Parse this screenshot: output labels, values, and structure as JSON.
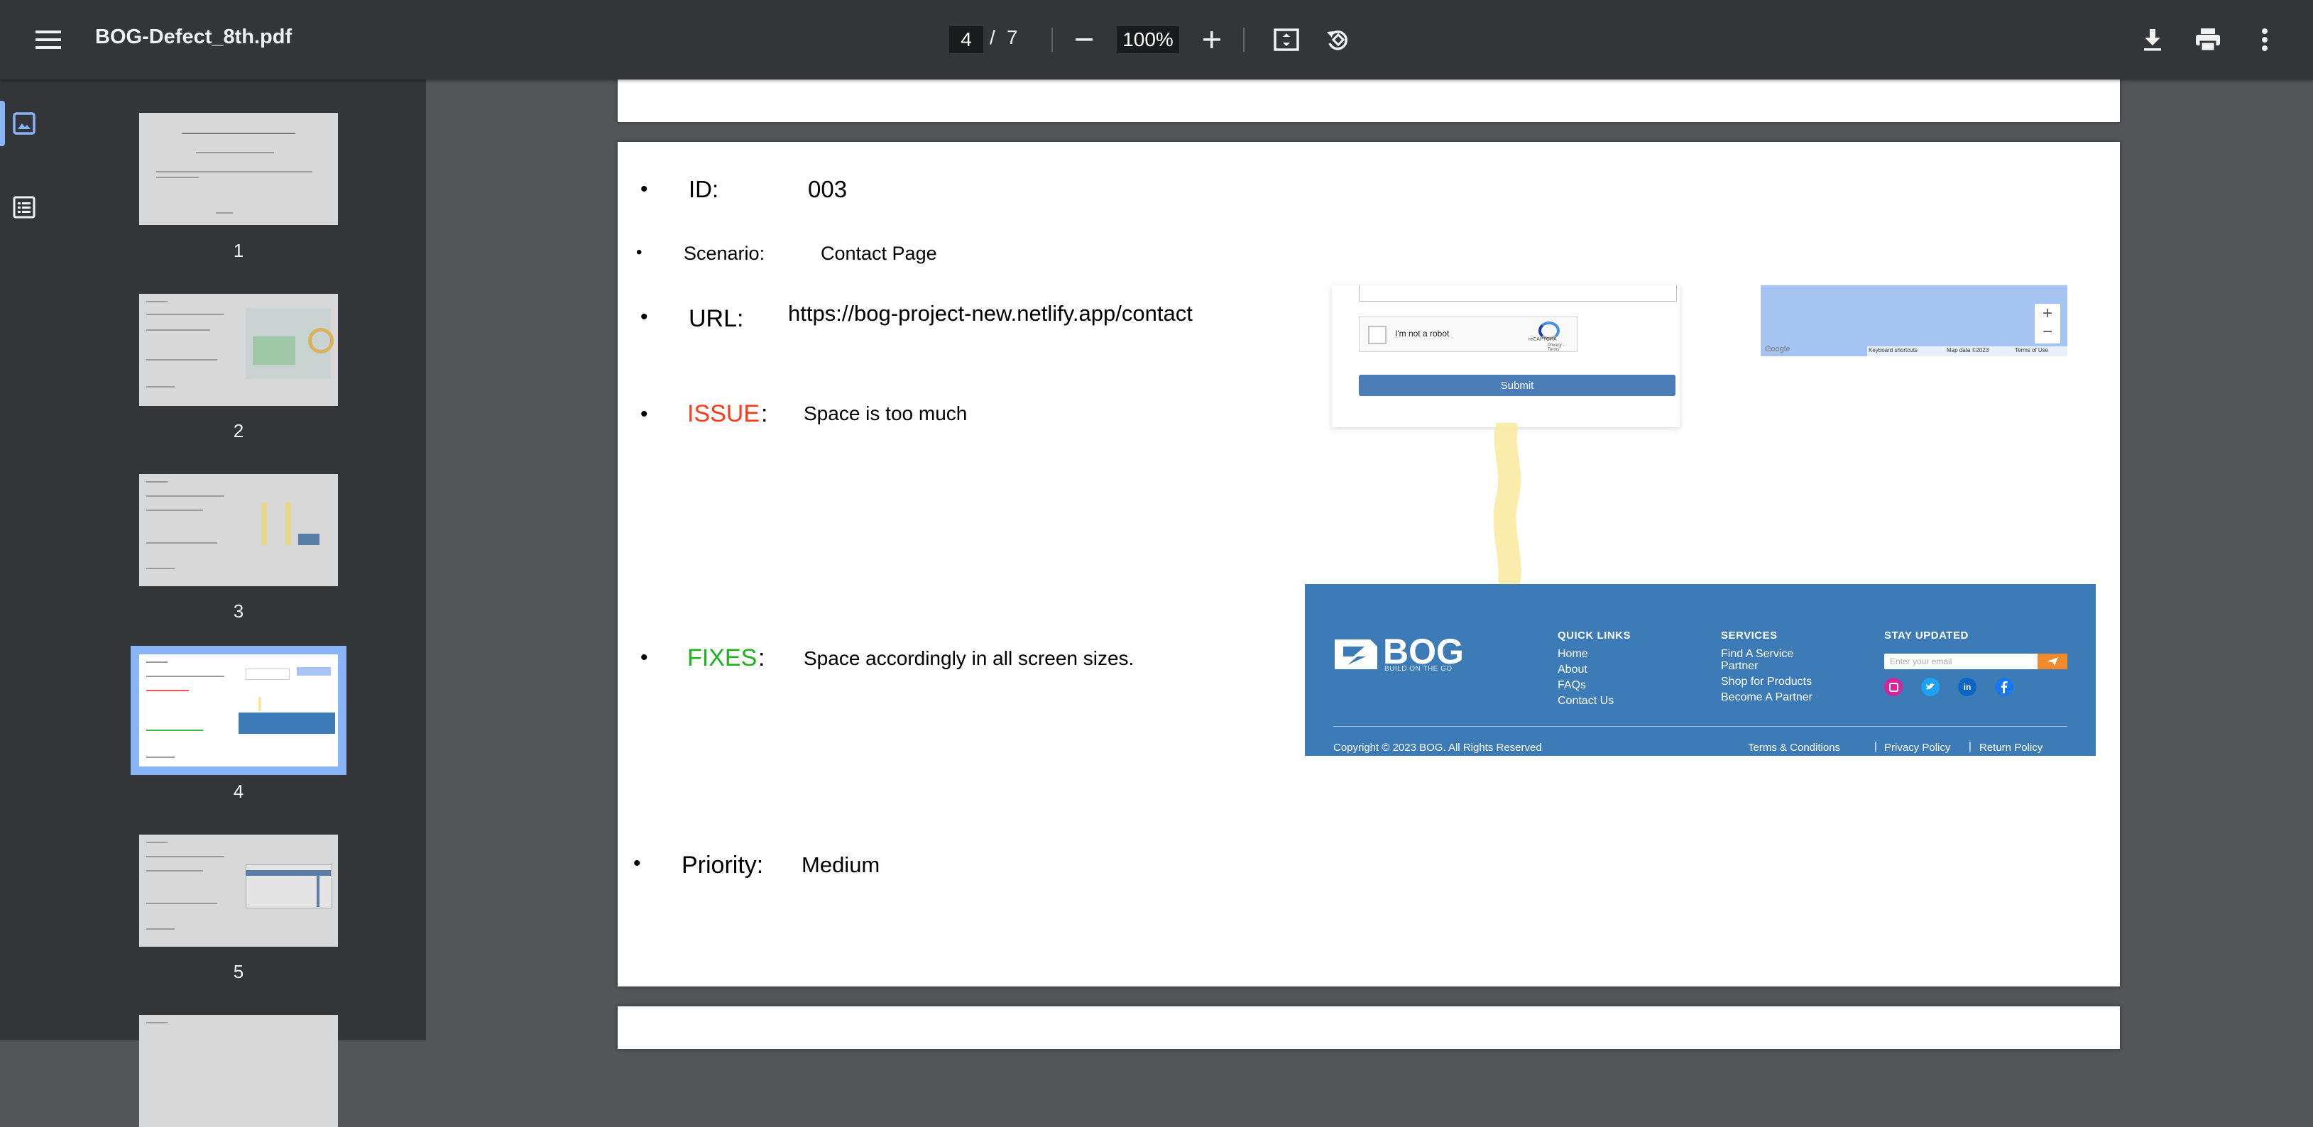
{
  "toolbar": {
    "filename": "BOG-Defect_8th.pdf",
    "current_page": "4",
    "separator": "/",
    "total_pages": "7",
    "zoom": "100%"
  },
  "sidebar": {
    "thumbnails": [
      {
        "number": "1"
      },
      {
        "number": "2"
      },
      {
        "number": "3"
      },
      {
        "number": "4",
        "selected": true
      },
      {
        "number": "5"
      }
    ]
  },
  "page4": {
    "id_label": "ID:",
    "id_value": "003",
    "scenario_label": "Scenario:",
    "scenario_value": "Contact Page",
    "url_label": "URL:",
    "url_value": "https://bog-project-new.netlify.app/contact",
    "issue_label": "ISSUE",
    "colon": ":",
    "issue_value": "Space is too much",
    "fixes_label": "FIXES",
    "fixes_value": "Space accordingly in all screen sizes.",
    "priority_label": "Priority:",
    "priority_value": "Medium",
    "bullet": "•"
  },
  "screenshot": {
    "captcha_label": "I'm not a robot",
    "captcha_brand": "reCAPTCHA",
    "captcha_links": "Privacy - Terms",
    "submit_label": "Submit",
    "map_google": "Google",
    "map_shortcuts": "Keyboard shortcuts",
    "map_data": "Map data ©2023",
    "map_terms": "Terms of Use",
    "map_zoom_in": "+",
    "map_zoom_out": "−"
  },
  "footer_shot": {
    "logo_text": "BOG",
    "tagline": "BUILD ON THE GO",
    "quick_links_heading": "QUICK LINKS",
    "quick_links": [
      "Home",
      "About",
      "FAQs",
      "Contact Us"
    ],
    "services_heading": "SERVICES",
    "services_line1": "Find A Service",
    "services_line2": "Partner",
    "services_line3": "Shop for Products",
    "services_line4": "Become A Partner",
    "stay_heading": "STAY UPDATED",
    "email_placeholder": "Enter your email",
    "copyright": "Copyright © 2023 BOG. All Rights Reserved",
    "terms": "Terms & Conditions",
    "privacy": "Privacy Policy",
    "returns": "Return Policy",
    "pipe": "|",
    "social_in": "in"
  },
  "colors": {
    "issue": "#ff3b1a",
    "fixes": "#1db31d",
    "toolbar_bg": "#323639",
    "accent": "#8ab4f8",
    "footer_blue": "#3c7bb5",
    "submit_blue": "#4a7db5"
  },
  "icons": [
    "menu-icon",
    "minus-icon",
    "plus-icon",
    "fit-page-icon",
    "rotate-icon",
    "download-icon",
    "print-icon",
    "more-vert-icon",
    "thumbnail-icon",
    "outline-icon"
  ]
}
